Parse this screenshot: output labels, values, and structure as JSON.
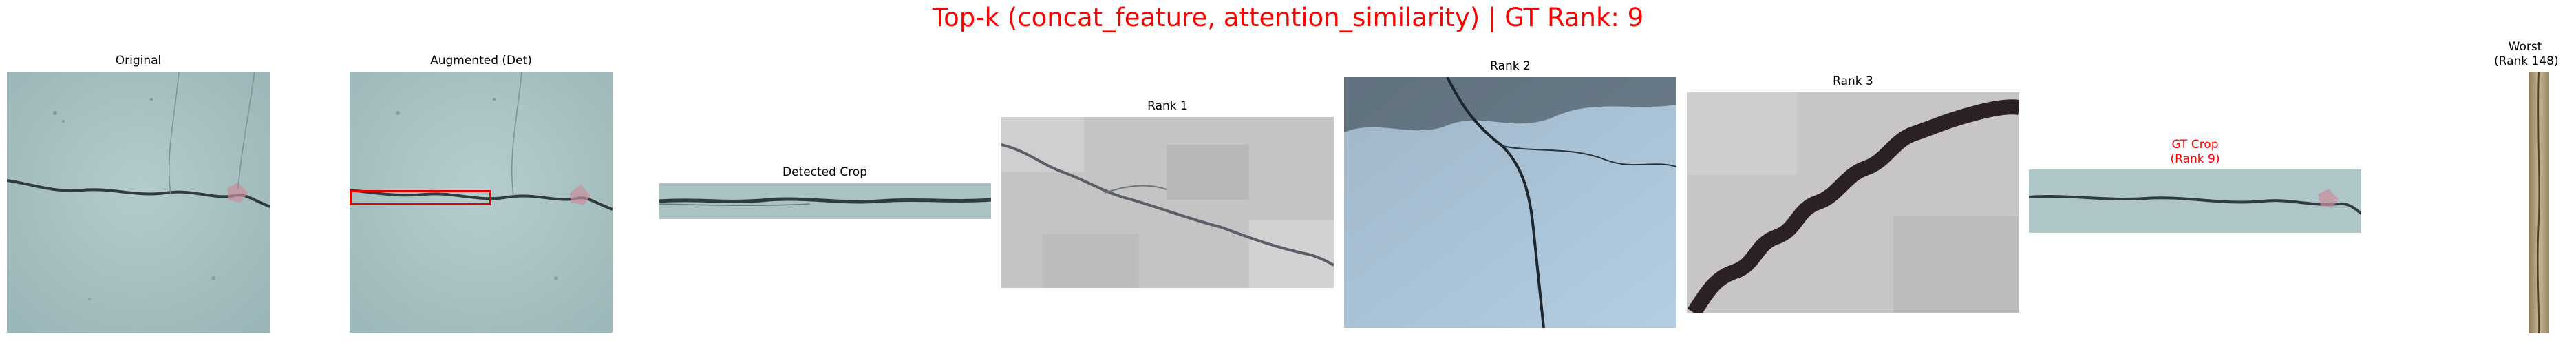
{
  "figure": {
    "title": "Top-k (concat_feature, attention_similarity) | GT Rank: 9",
    "panels": {
      "original": "Original",
      "augmented": "Augmented (Det)",
      "detected_crop": "Detected Crop",
      "rank1": "Rank 1",
      "rank2": "Rank 2",
      "rank3": "Rank 3",
      "gt_crop_line1": "GT Crop",
      "gt_crop_line2": "(Rank 9)",
      "worst_line1": "Worst",
      "worst_line2": "(Rank 148)"
    }
  },
  "colors": {
    "title": "#ff0000",
    "gt_title": "#ff0000",
    "detection_box": "#e00000",
    "concrete_teal": "#a9c3c4",
    "concrete_gray": "#c9c9c9",
    "concrete_blue": "#a8c0d6",
    "crack": "#3a3a3a"
  }
}
